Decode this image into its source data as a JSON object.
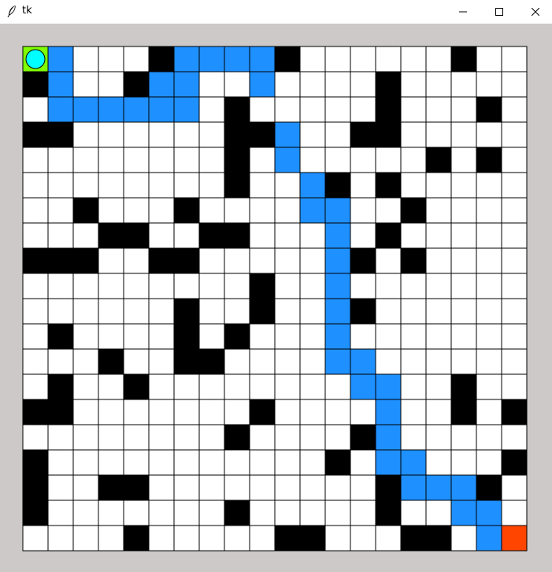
{
  "window": {
    "title": "tk",
    "icon": "feather-icon",
    "controls": [
      "minimize-icon",
      "maximize-icon",
      "close-icon"
    ]
  },
  "maze": {
    "rows": 20,
    "cols": 20,
    "colors": {
      "open": "#ffffff",
      "wall": "#000000",
      "path": "#1e90ff",
      "start": "#7fff00",
      "goal": "#ff4500",
      "agent": "#00ffff",
      "gridline": "#000000",
      "background": "#cdc9c8"
    },
    "legend": {
      "0": "open",
      "1": "wall",
      "2": "path",
      "3": "start",
      "4": "goal"
    },
    "grid": [
      "32000122221000000100",
      "12001220020000100000",
      "02222220100000100010",
      "11000000112001100000",
      "00000000102000001010",
      "00000000100210100000",
      "00100010000220010000",
      "00011001100020100000",
      "11100110000021010000",
      "00000000010020000000",
      "00000010010021000000",
      "01000010100020000000",
      "00010011000022000000",
      "01001000000002200100",
      "11000000010000200101",
      "00000000100001200000",
      "10000000000010220001",
      "10011000000000122210",
      "10000000100000100220",
      "00001000001100011024"
    ],
    "agent": {
      "row": 0,
      "col": 0
    }
  }
}
